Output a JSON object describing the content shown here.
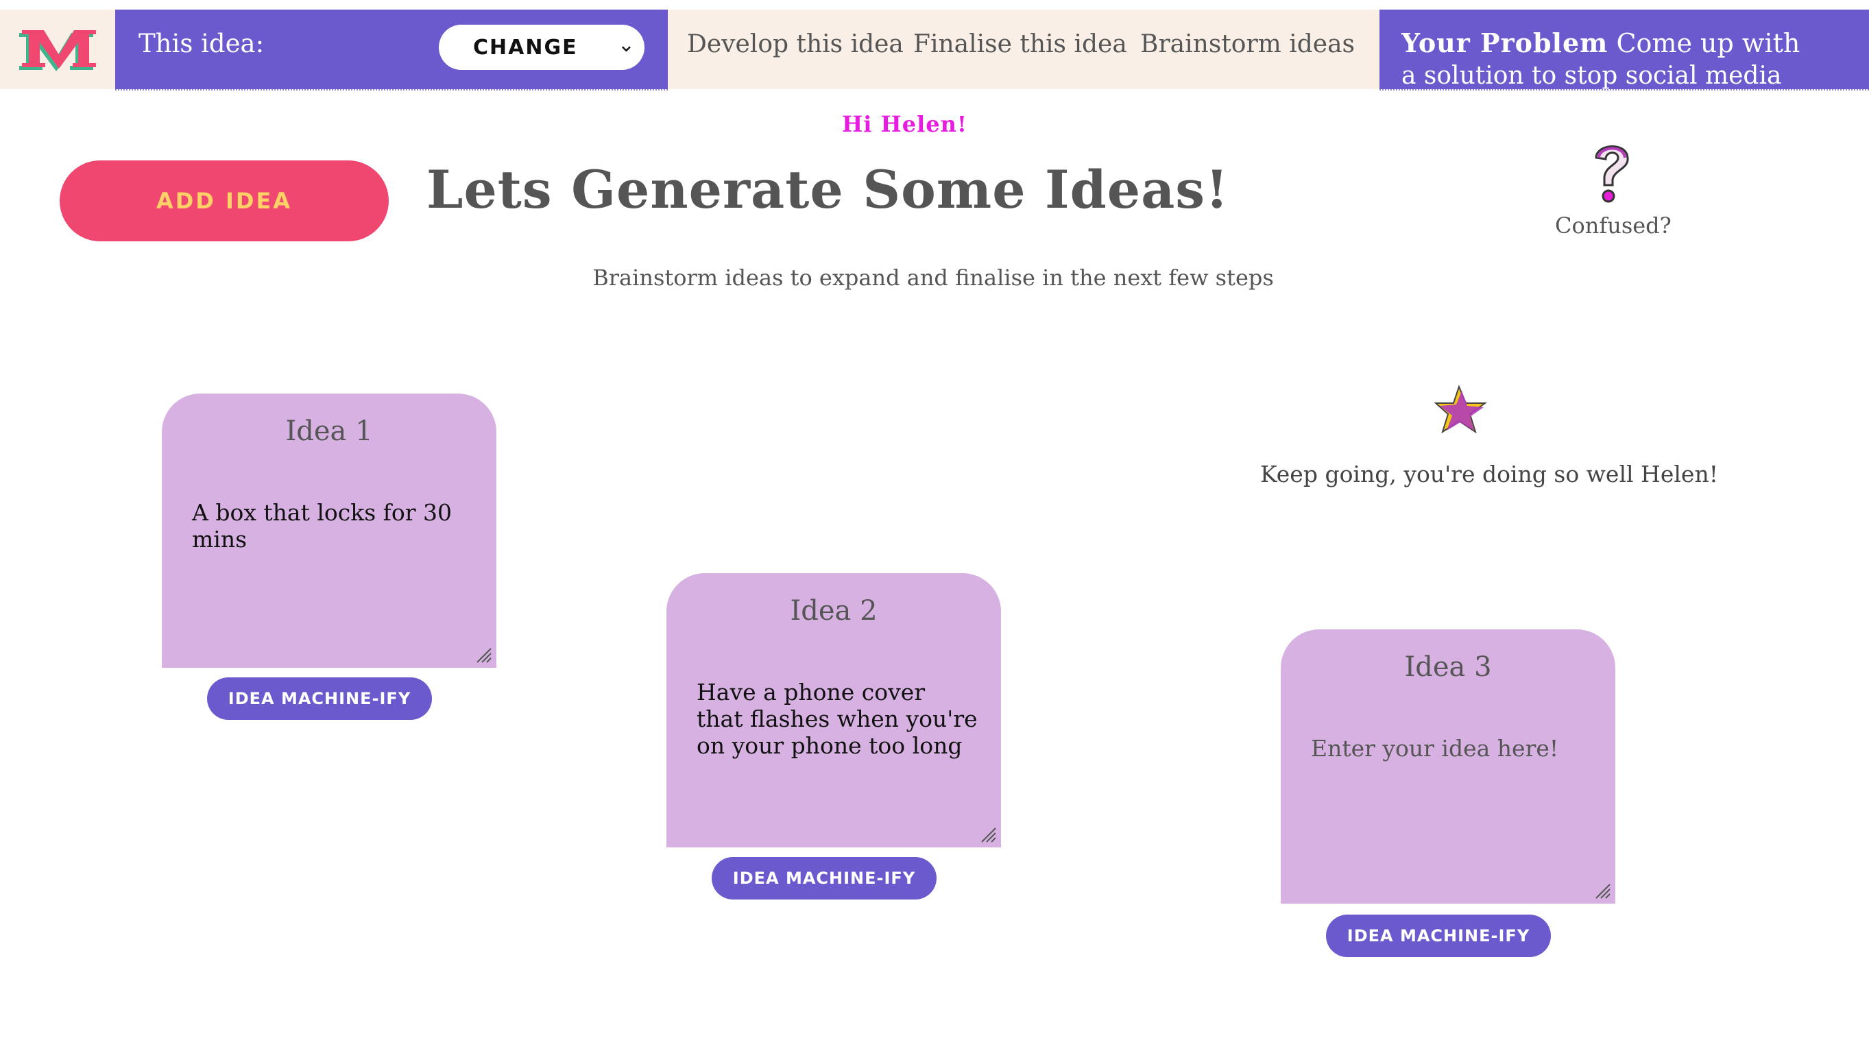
{
  "header": {
    "logo_letter": "M",
    "this_idea_label": "This idea:",
    "change_select": {
      "value": "CHANGE"
    },
    "nav": [
      "Develop this idea",
      "Finalise this idea",
      "Brainstorm ideas"
    ],
    "problem": {
      "heading": "Your Problem",
      "text_line1": "Come up with",
      "text_line2": "a solution to stop social media"
    }
  },
  "main": {
    "greeting": "Hi Helen!",
    "add_idea_label": "ADD IDEA",
    "title": "Lets Generate Some Ideas!",
    "confused_label": "Confused?",
    "subtitle": "Brainstorm ideas to expand and finalise in the next few steps",
    "encouragement": "Keep going, you're doing so well Helen!"
  },
  "ideas": [
    {
      "title": "Idea 1",
      "text": "A box that locks for 30 mins",
      "placeholder": "Enter your idea here!",
      "button": "IDEA MACHINE-IFY"
    },
    {
      "title": "Idea 2",
      "text": "Have a phone cover that flashes when you're on your phone too long",
      "placeholder": "Enter your idea here!",
      "button": "IDEA MACHINE-IFY"
    },
    {
      "title": "Idea 3",
      "text": "",
      "placeholder": "Enter your idea here!",
      "button": "IDEA MACHINE-IFY"
    }
  ],
  "colors": {
    "purple": "#6b5acd",
    "cream": "#f9efe6",
    "pink_button": "#ef476f",
    "yellow_text": "#ffd166",
    "card_lilac": "#d7b1e2",
    "greeting_magenta": "#e81be0"
  },
  "icons": {
    "logo": "m-logo-icon",
    "select_arrow": "chevron-down-icon",
    "help": "question-mark-icon",
    "reward": "star-icon",
    "resize": "resize-handle-icon"
  }
}
